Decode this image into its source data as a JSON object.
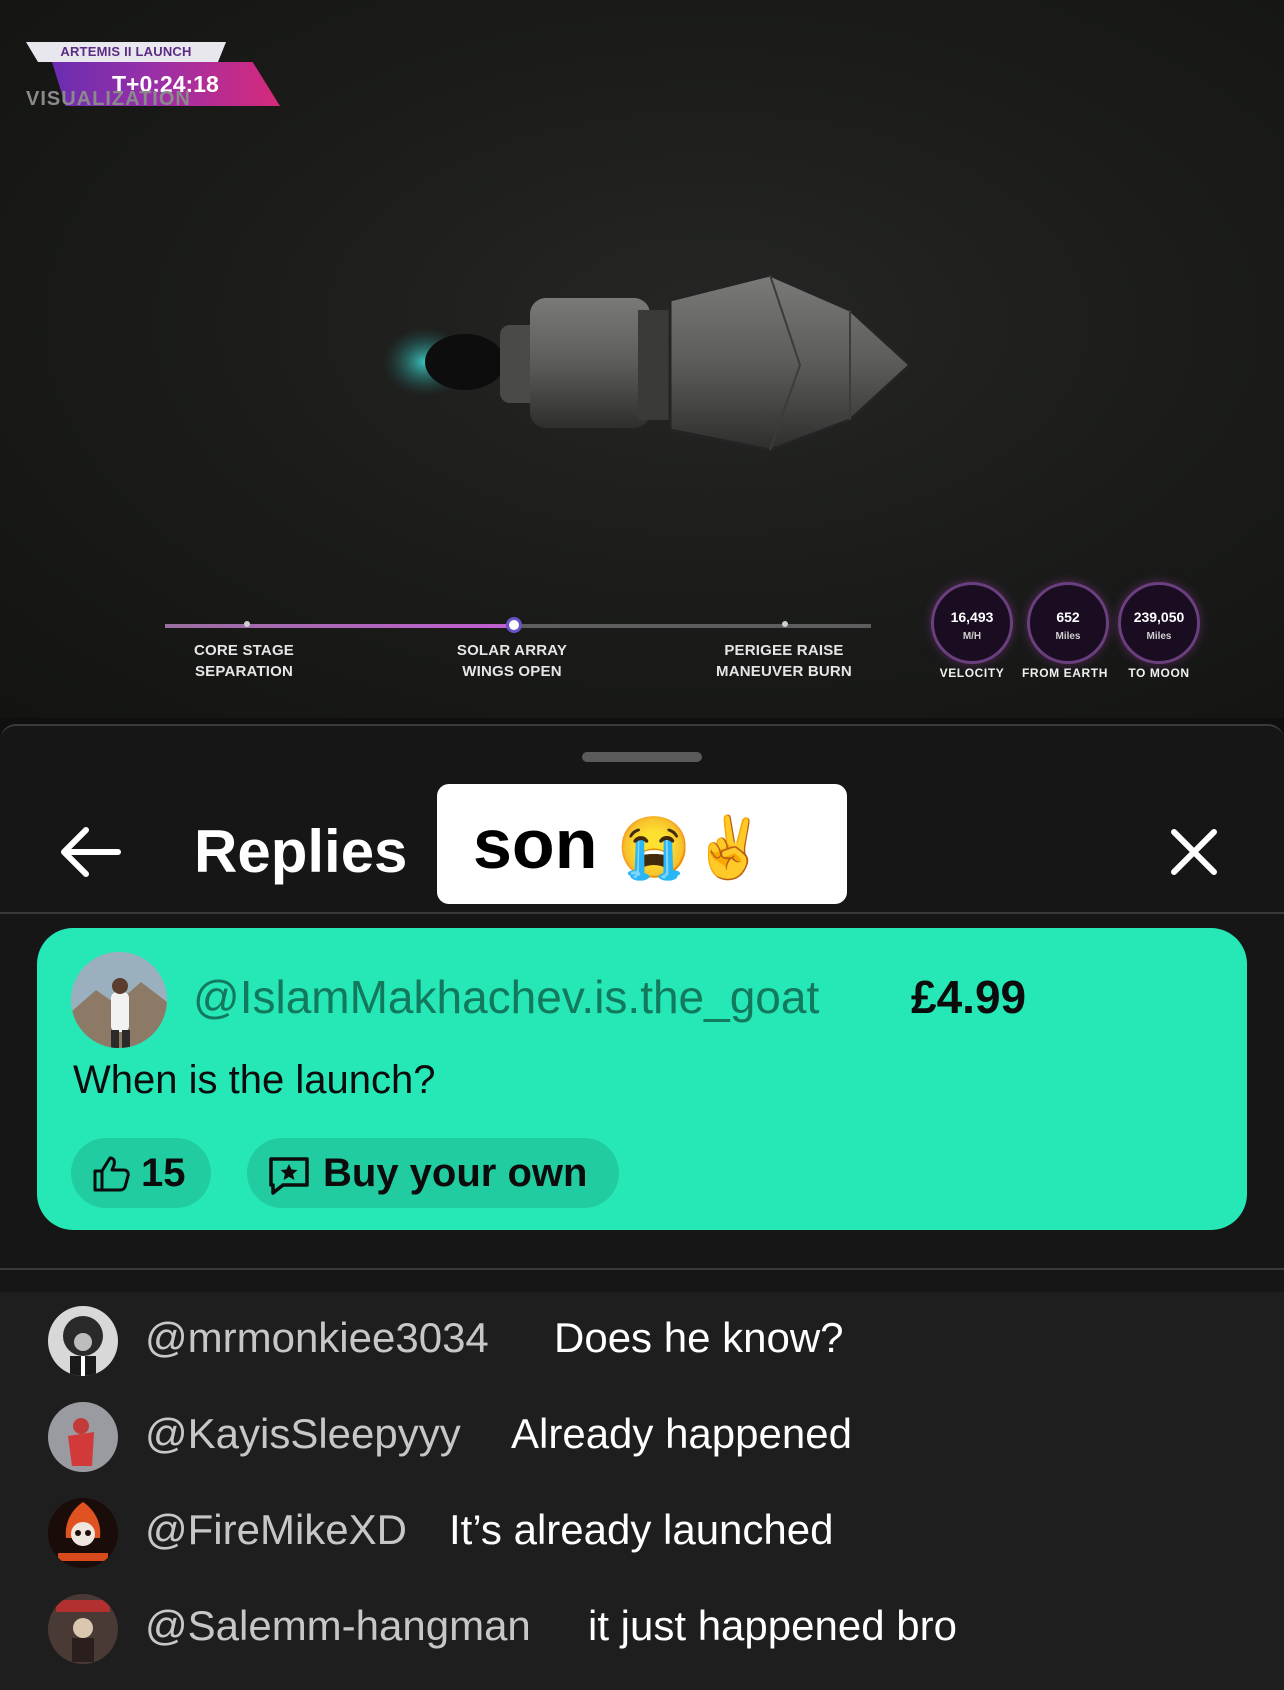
{
  "video": {
    "event_title": "ARTEMIS II LAUNCH",
    "mission_clock": "T+0:24:18",
    "overlay_label": "VISUALIZATION",
    "timeline": {
      "progress": 0.49,
      "milestones": [
        {
          "label_line1": "CORE STAGE",
          "label_line2": "SEPARATION"
        },
        {
          "label_line1": "SOLAR ARRAY",
          "label_line2": "WINGS OPEN"
        },
        {
          "label_line1": "PERIGEE RAISE",
          "label_line2": "MANEUVER BURN"
        }
      ]
    },
    "gauges": [
      {
        "value": "16,493",
        "unit": "M/H",
        "label": "VELOCITY"
      },
      {
        "value": "652",
        "unit": "Miles",
        "label": "FROM EARTH"
      },
      {
        "value": "239,050",
        "unit": "Miles",
        "label": "TO MOON"
      }
    ]
  },
  "sheet": {
    "title": "Replies",
    "sticker_text": "son",
    "sticker_emoji": "😭✌️",
    "back_icon": "arrow-left-icon",
    "close_icon": "close-icon"
  },
  "super_chat": {
    "username": "@IslamMakhachev.is.the_goat",
    "amount": "£4.99",
    "message": "When is the launch?",
    "like_count": "15",
    "buy_label": "Buy your own",
    "colors": {
      "background": "#26e8b7",
      "username": "#12795d"
    }
  },
  "replies": [
    {
      "username": "@mrmonkiee3034",
      "text": "Does he know?"
    },
    {
      "username": "@KayisSleepyyy",
      "text": "Already happened"
    },
    {
      "username": "@FireMikeXD",
      "text": "It’s already launched"
    },
    {
      "username": "@Salemm-hangman",
      "text": "it just happened bro"
    }
  ]
}
